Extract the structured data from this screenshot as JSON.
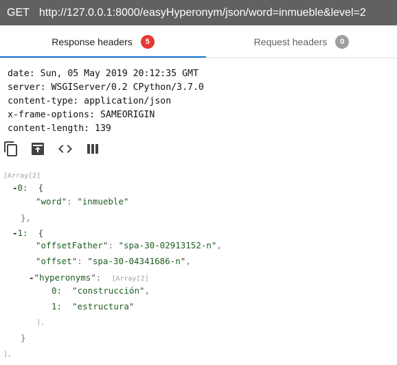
{
  "url_bar": {
    "method": "GET",
    "url": "http://127.0.0.1:8000/easyHyperonym/json/word=inmueble&level=2"
  },
  "tabs": {
    "response": {
      "label": "Response headers",
      "count": "5"
    },
    "request": {
      "label": "Request headers",
      "count": "0"
    }
  },
  "response_headers": [
    "date: Sun, 05 May 2019 20:12:35 GMT",
    "server: WSGIServer/0.2 CPython/3.7.0",
    "content-type: application/json",
    "x-frame-options: SAMEORIGIN",
    "content-length: 139"
  ],
  "toolbar": {
    "icons": [
      "copy-icon",
      "save-icon",
      "code-icon",
      "columns-icon"
    ]
  },
  "json_view": {
    "root_meta": "[Array[2]",
    "item0": {
      "index": "0:",
      "brace_open": "{",
      "key_word": "word",
      "val_word": "inmueble",
      "brace_close": "},"
    },
    "item1": {
      "index": "1:",
      "brace_open": "{",
      "key_offsetFather": "offsetFather",
      "val_offsetFather": "spa-30-02913152-n",
      "key_offset": "offset",
      "val_offset": "spa-30-04341686-n",
      "key_hyperonyms": "hyperonyms",
      "hyperonyms_meta": "[Array[2]",
      "h0_index": "0:",
      "h0_value": "construcción",
      "h1_index": "1:",
      "h1_value": "estructura",
      "array_close": "],",
      "brace_close": "}"
    },
    "root_close": "],",
    "toggle_minus": "-"
  }
}
